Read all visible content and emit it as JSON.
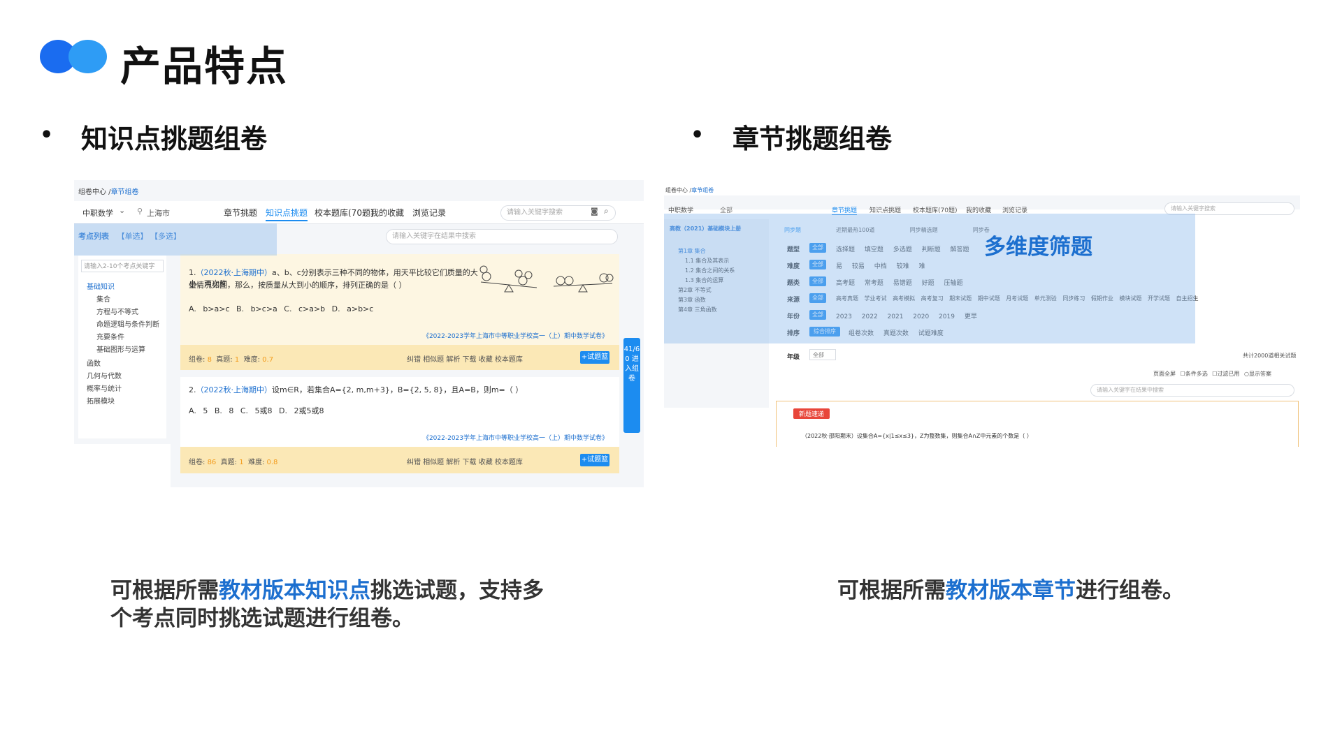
{
  "header": {
    "title": "产品特点"
  },
  "left": {
    "bullet": "•",
    "section_title": "知识点挑题组卷",
    "desc_pre": "可根据所需",
    "desc_hl": "教材版本知识点",
    "desc_post": "挑选试题，支持多",
    "desc_line2": "个考点同时挑选试题进行组卷。",
    "shot": {
      "breadcrumb_root": "组卷中心 /",
      "breadcrumb_current": "章节组卷",
      "subject": "中职数学",
      "region": "上海市",
      "tabs": [
        "章节挑题",
        "知识点挑题",
        "校本题库(70题)",
        "我的收藏",
        "浏览记录"
      ],
      "search_placeholder": "请输入关键字搜索",
      "panel_head": "考点列表",
      "panel_single": "【单选】",
      "panel_multi": "【多选】",
      "result_search": "请输入关键字在结果中搜索",
      "kp_search": "请输入2-10个考点关键字",
      "tree": [
        "基础知识",
        "集合",
        "方程与不等式",
        "命题逻辑与条件判断",
        "充要条件",
        "基础图形与运算",
        "函数",
        "几何与代数",
        "概率与统计",
        "拓展模块"
      ],
      "q1_tag": "（2022秋·上海期中）",
      "q1_num": "1.",
      "q1_text": "a、b、c分别表示三种不同的物体，用天平比较它们质量的大小，两次称",
      "q1_text2": "量情况如图，那么，按质量从大到小的顺序，排列正确的是（    ）",
      "q1_opts": "A. b>a>c   B. b>c>a   C. c>a>b   D. a>b>c",
      "q1_src": "《2022-2023学年上海市中等职业学校高一（上）期中数学试卷》",
      "q1_meta": [
        "组卷:",
        "8",
        "真题:",
        "1",
        "难度:",
        "0.7"
      ],
      "q2_num": "2.",
      "q2_tag": "（2022秋·上海期中）",
      "q2_text": "设m∈R，若集合A={2, m,m+3}，B={2, 5, 8}，且A=B，则m=（    ）",
      "q2_opts": "A. 5      B. 8      C. 5或8      D. 2或5或8",
      "q2_src": "《2022-2023学年上海市中等职业学校高一（上）期中数学试卷》",
      "q2_meta": [
        "组卷:",
        "86",
        "真题:",
        "1",
        "难度:",
        "0.8"
      ],
      "actions": "纠错  相似题  解析  下载  收藏  校本题库",
      "add_btn": "+试题篮",
      "side_tab": "41/60 进入组卷"
    }
  },
  "right": {
    "bullet": "•",
    "section_title": "章节挑题组卷",
    "desc_pre": "可根据所需",
    "desc_hl": "教材版本章节",
    "desc_post": "进行组卷。",
    "overlay_label": "多维度筛题",
    "shot": {
      "breadcrumb_root": "组卷中心 /",
      "breadcrumb_current": "章节组卷",
      "subject": "中职数学",
      "region": "全部",
      "tabs": [
        "章节挑题",
        "知识点挑题",
        "校本题库(70题)",
        "我的收藏",
        "浏览记录"
      ],
      "search_placeholder": "请输入关键字搜索",
      "textbook": "高教（2021）基础模块上册",
      "subtabs": [
        "同步题",
        "近期最热100道",
        "同步精选题",
        "同步卷"
      ],
      "tree": [
        "第1章 集合",
        "1.1 集合及其表示",
        "1.2 集合之间的关系",
        "1.3 集合的运算",
        "第2章 不等式",
        "第3章 函数",
        "第4章 三角函数"
      ],
      "filters": [
        {
          "label": "题型",
          "chip": "全部",
          "opts": "选择题 填空题 多选题 判断题 解答题"
        },
        {
          "label": "难度",
          "chip": "全部",
          "opts": "易 较易 中档 较难 难"
        },
        {
          "label": "题类",
          "chip": "全部",
          "opts": "高考题 常考题 易错题 好题 压轴题"
        },
        {
          "label": "来源",
          "chip": "全部",
          "opts": "高考真题 学业考试 高考模拟 高考复习 期末试题 期中试题 月考试题 单元测验 同步练习 假期作业 模块试题 开学试题 自主招生"
        },
        {
          "label": "年份",
          "chip": "全部",
          "opts": "2023 2022 2021 2020 2019 更早"
        },
        {
          "label": "排序",
          "chip": "综合排序",
          "opts": "组卷次数 真题次数 试题难度"
        }
      ],
      "grade_label": "年级",
      "grade_value": "全部",
      "total": "共计2000道相关试题",
      "options": [
        "页面全屏",
        "条件多选",
        "过滤已用",
        "显示答案"
      ],
      "result_search": "请输入关键字在结果中搜索",
      "new_badge": "新题速递",
      "q_text": "（2022秋·邵阳期末）设集合A={x|1≤x≤3}，Z为整数集，则集合A∩Z中元素的个数是（    ）"
    }
  }
}
